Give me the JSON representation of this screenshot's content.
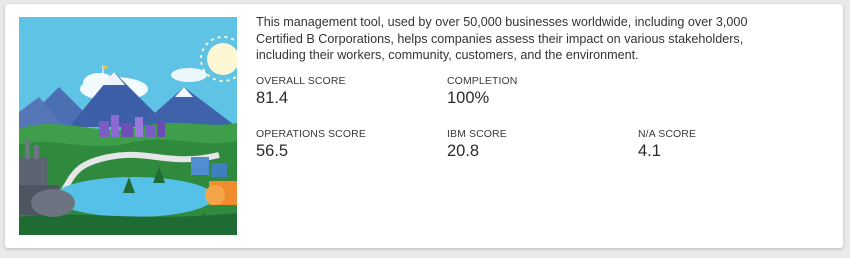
{
  "card": {
    "description": "This management tool, used by over 50,000 businesses worldwide, including over 3,000 Certified B Corporations, helps companies assess their impact on various stakeholders, including their workers, community, customers, and the environment.",
    "metrics": {
      "overall": {
        "label": "OVERALL SCORE",
        "value": "81.4"
      },
      "completion": {
        "label": "COMPLETION",
        "value": "100%"
      },
      "operations": {
        "label": "OPERATIONS SCORE",
        "value": "56.5"
      },
      "ibm": {
        "label": "IBM SCORE",
        "value": "20.8"
      },
      "na": {
        "label": "N/A SCORE",
        "value": "4.1"
      }
    }
  }
}
